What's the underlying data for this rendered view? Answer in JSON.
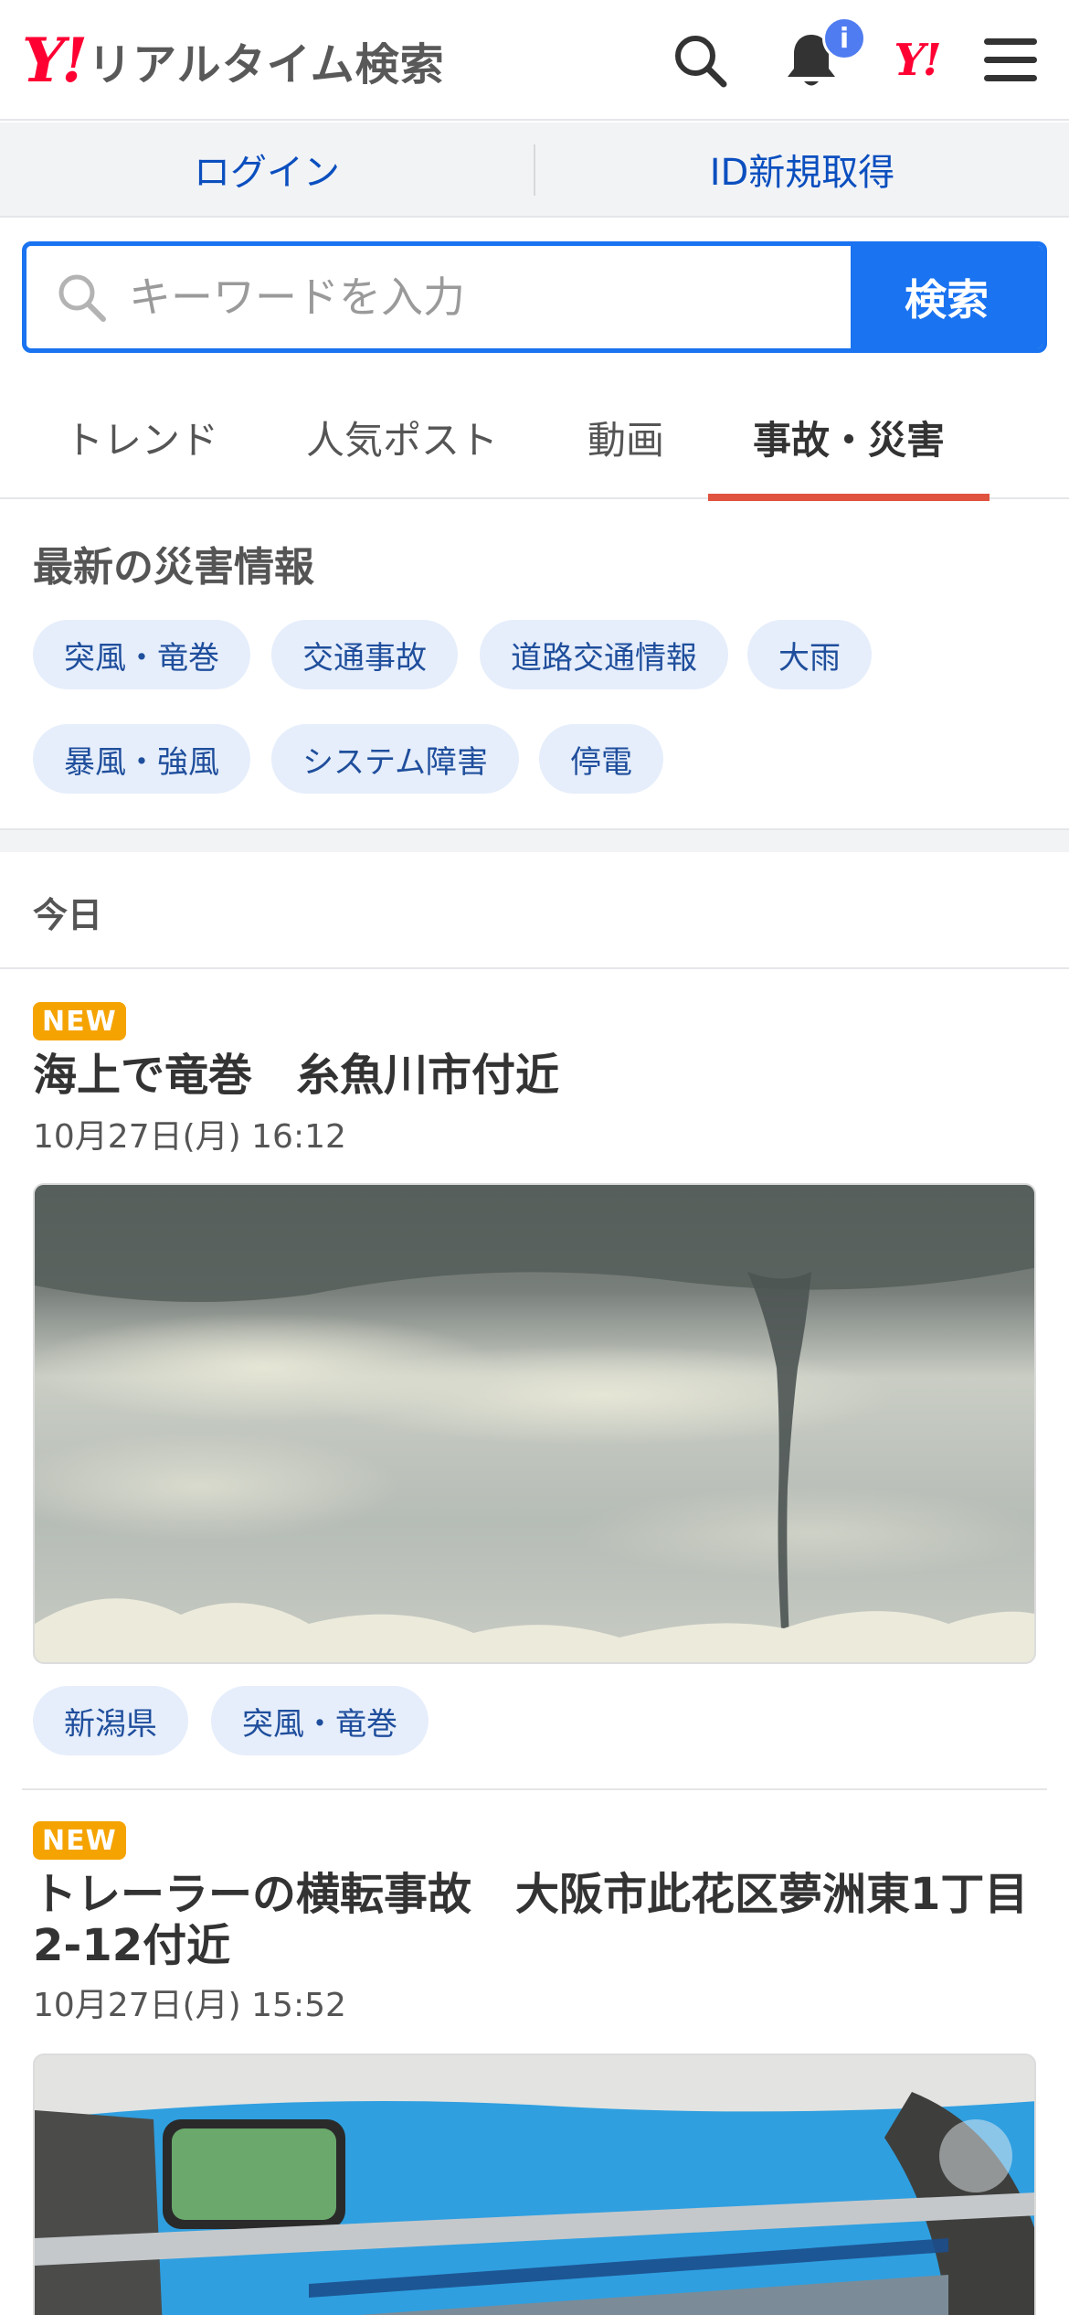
{
  "header": {
    "logo_mark": "Y!",
    "logo_text": "リアルタイム検索",
    "notification_badge": "i",
    "yahoo_mark": "Y!"
  },
  "account": {
    "login_label": "ログイン",
    "signup_label": "ID新規取得"
  },
  "search": {
    "placeholder": "キーワードを入力",
    "button_label": "検索"
  },
  "tabs": [
    {
      "label": "トレンド",
      "active": false
    },
    {
      "label": "人気ポスト",
      "active": false
    },
    {
      "label": "動画",
      "active": false
    },
    {
      "label": "事故・災害",
      "active": true
    }
  ],
  "disaster": {
    "heading": "最新の災害情報",
    "chips": [
      "突風・竜巻",
      "交通事故",
      "道路交通情報",
      "大雨",
      "暴風・強風",
      "システム障害",
      "停電"
    ]
  },
  "section_label": "今日",
  "articles": [
    {
      "badge": "NEW",
      "title": "海上で竜巻　糸魚川市付近",
      "date": "10月27日(月) 16:12",
      "tags": [
        "新潟県",
        "突風・竜巻"
      ]
    },
    {
      "badge": "NEW",
      "title": "トレーラーの横転事故　大阪市此花区夢洲東1丁目2-12付近",
      "date": "10月27日(月) 15:52",
      "tags": []
    }
  ],
  "colors": {
    "brand_red": "#ff0033",
    "accent_blue": "#1a73f0",
    "tab_indicator": "#e0533f",
    "new_badge": "#f5a300",
    "chip_bg": "#e6eefb"
  }
}
